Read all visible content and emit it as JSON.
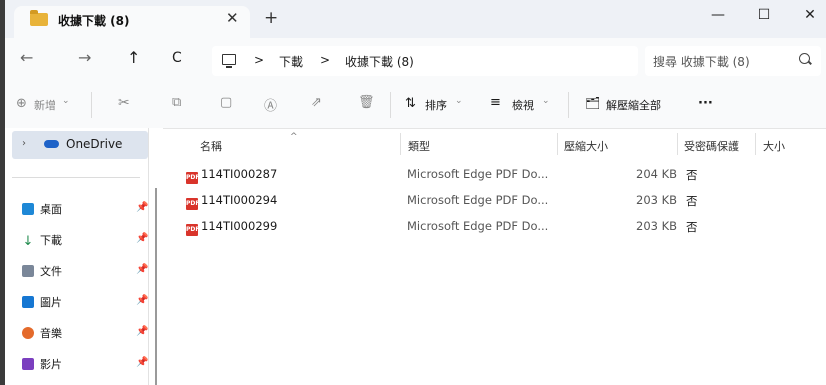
{
  "window": {
    "tab_title": "收據下載 (8)",
    "new_tab": "+",
    "close_tab": "✕",
    "minimize": "—",
    "maximize": "☐",
    "close": "✕"
  },
  "nav": {
    "back": "←",
    "forward": "→",
    "up": "↑",
    "refresh": "C"
  },
  "address": {
    "sep1": ">",
    "crumb1": "下載",
    "sep2": ">",
    "crumb2": "收據下載 (8)"
  },
  "search": {
    "placeholder": "搜尋 收據下載 (8)"
  },
  "toolbar": {
    "new_label": "新增",
    "sort_label": "排序",
    "view_label": "檢視",
    "extract_label": "解壓縮全部",
    "more_label": "···"
  },
  "sidebar": {
    "onedrive": "OneDrive",
    "quick": [
      {
        "label": "桌面",
        "color": "#1e88d6"
      },
      {
        "label": "下載",
        "color": "#1f8a4c"
      },
      {
        "label": "文件",
        "color": "#7a8799"
      },
      {
        "label": "圖片",
        "color": "#1677d2"
      },
      {
        "label": "音樂",
        "color": "#e46a2b"
      },
      {
        "label": "影片",
        "color": "#7b3fbf"
      }
    ]
  },
  "columns": {
    "name": "名稱",
    "type": "類型",
    "compressed_size": "壓縮大小",
    "password": "受密碼保護",
    "size": "大小"
  },
  "files": [
    {
      "name": "114TI000287",
      "type": "Microsoft Edge PDF Do...",
      "compressed": "204 KB",
      "password": "否"
    },
    {
      "name": "114TI000294",
      "type": "Microsoft Edge PDF Do...",
      "compressed": "203 KB",
      "password": "否"
    },
    {
      "name": "114TI000299",
      "type": "Microsoft Edge PDF Do...",
      "compressed": "203 KB",
      "password": "否"
    }
  ]
}
